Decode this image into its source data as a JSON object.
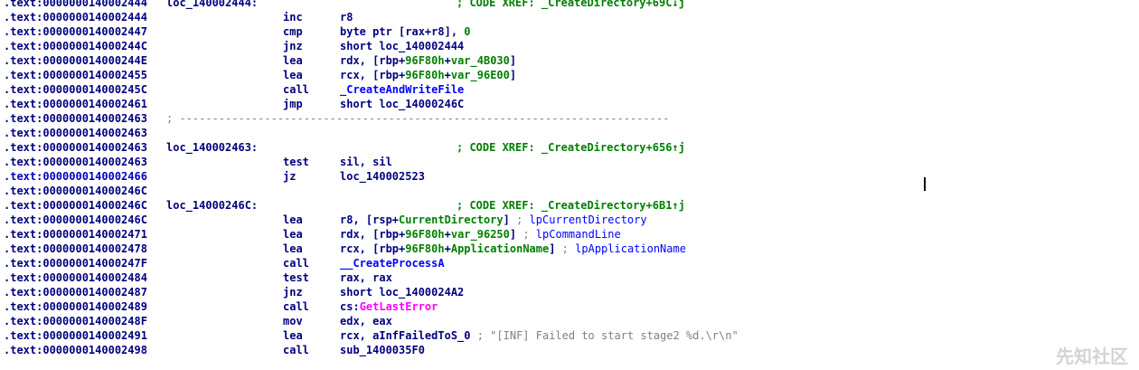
{
  "watermark": "先知社区",
  "lines": [
    {
      "addr": ".text:0000000140002444",
      "label": "loc_140002444:",
      "xref": "; CODE XREF: _CreateDirectory+69C↓j"
    },
    {
      "addr": ".text:0000000140002444",
      "mn": "inc",
      "ops": "r8"
    },
    {
      "addr": ".text:0000000140002447",
      "mn": "cmp",
      "ops": "byte ptr [rax+r8], 0"
    },
    {
      "addr": ".text:000000014000244C",
      "mn": "jnz",
      "ops": "short loc_140002444"
    },
    {
      "addr": ".text:000000014000244E",
      "mn": "lea",
      "ops": "rdx, [rbp+96F80h+var_4B030]"
    },
    {
      "addr": ".text:0000000140002455",
      "mn": "lea",
      "ops": "rcx, [rbp+96F80h+var_96E00]"
    },
    {
      "addr": ".text:000000014000245C",
      "mn": "call",
      "ops": "_CreateAndWriteFile"
    },
    {
      "addr": ".text:0000000140002461",
      "mn": "jmp",
      "ops": "short loc_14000246C"
    },
    {
      "addr": ".text:0000000140002463",
      "sep": "; ---------------------------------------------------------------------------"
    },
    {
      "addr": ".text:0000000140002463"
    },
    {
      "addr": ".text:0000000140002463",
      "label": "loc_140002463:",
      "xref": "; CODE XREF: _CreateDirectory+656↑j"
    },
    {
      "addr": ".text:0000000140002463",
      "mn": "test",
      "ops": "sil, sil"
    },
    {
      "addr": ".text:0000000140002466",
      "mn": "jz",
      "ops": "loc_140002523",
      "selected": true
    },
    {
      "addr": ".text:000000014000246C"
    },
    {
      "addr": ".text:000000014000246C",
      "label": "loc_14000246C:",
      "xref": "; CODE XREF: _CreateDirectory+6B1↑j"
    },
    {
      "addr": ".text:000000014000246C",
      "mn": "lea",
      "ops": "r8, [rsp+CurrentDirectory] ; lpCurrentDirectory"
    },
    {
      "addr": ".text:0000000140002471",
      "mn": "lea",
      "ops": "rdx, [rbp+96F80h+var_96250] ; lpCommandLine"
    },
    {
      "addr": ".text:0000000140002478",
      "mn": "lea",
      "ops": "rcx, [rbp+96F80h+ApplicationName] ; lpApplicationName"
    },
    {
      "addr": ".text:000000014000247F",
      "mn": "call",
      "ops": "__CreateProcessA"
    },
    {
      "addr": ".text:0000000140002484",
      "mn": "test",
      "ops": "rax, rax"
    },
    {
      "addr": ".text:0000000140002487",
      "mn": "jnz",
      "ops": "short loc_1400024A2"
    },
    {
      "addr": ".text:0000000140002489",
      "mn": "call",
      "ops": "cs:GetLastError"
    },
    {
      "addr": ".text:000000014000248F",
      "mn": "mov",
      "ops": "edx, eax"
    },
    {
      "addr": ".text:0000000140002491",
      "mn": "lea",
      "ops": "rcx, aInfFailedToS_0 ; \"[INF] Failed to start stage2 %d.\\r\\n\""
    },
    {
      "addr": ".text:0000000140002498",
      "mn": "call",
      "ops": "sub_1400035F0"
    }
  ]
}
